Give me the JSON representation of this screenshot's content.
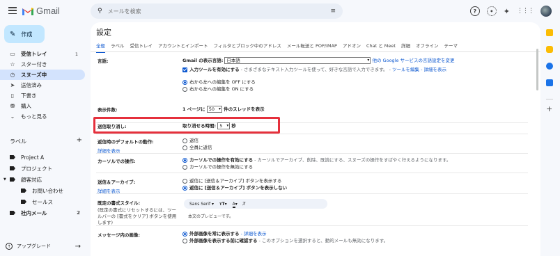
{
  "app": {
    "name": "Gmail"
  },
  "search": {
    "placeholder": "メールを検索"
  },
  "compose": {
    "label": "作成"
  },
  "nav": [
    {
      "label": "受信トレイ",
      "count": "1",
      "icon": "inbox-icon",
      "glyph": "▭",
      "bold": true
    },
    {
      "label": "スター付き",
      "count": "",
      "icon": "star-icon",
      "glyph": "☆"
    },
    {
      "label": "スヌーズ中",
      "count": "",
      "icon": "clock-icon",
      "glyph": "◷",
      "active": true
    },
    {
      "label": "送信済み",
      "count": "",
      "icon": "send-icon",
      "glyph": "➤"
    },
    {
      "label": "下書き",
      "count": "",
      "icon": "draft-icon",
      "glyph": "▯"
    },
    {
      "label": "購入",
      "count": "",
      "icon": "bag-icon",
      "glyph": "⛃"
    },
    {
      "label": "もっと見る",
      "count": "",
      "icon": "chevron-down-icon",
      "glyph": "⌄"
    }
  ],
  "labels": {
    "heading": "ラベル",
    "add": "+",
    "items": [
      {
        "label": "Project A"
      },
      {
        "label": "プロジェクト"
      },
      {
        "label": "顧客対応",
        "expanded": true
      },
      {
        "label": "お問い合わせ",
        "sub": true
      },
      {
        "label": "セールス",
        "sub": true
      },
      {
        "label": "社内メール",
        "count": "2",
        "bold": true
      }
    ]
  },
  "upgrade": {
    "label": "アップグレード"
  },
  "settings": {
    "title": "設定",
    "tabs": [
      "全般",
      "ラベル",
      "受信トレイ",
      "アカウントとインポート",
      "フィルタとブロック中のアドレス",
      "メール転送と POP/IMAP",
      "アドオン",
      "Chat と Meet",
      "詳細",
      "オフライン",
      "テーマ"
    ],
    "language": {
      "label": "言語:",
      "display_prefix": "Gmail の表示言語:",
      "display_value": "日本語",
      "display_link": "他の Google サービスの言語設定を変更",
      "input_check": "入力ツールを有効にする",
      "input_desc": " - さまざまなテキスト入力ツールを使って、好きな言語で入力できます。 - ",
      "input_link": "ツールを編集 - 詳細を表示",
      "rtl_off": "右から左への編集を OFF にする",
      "rtl_on": "右から左への編集を ON にする"
    },
    "page_size": {
      "label": "表示件数:",
      "prefix": "1 ページに",
      "value": "50",
      "suffix": "件のスレッドを表示"
    },
    "undo_send": {
      "label": "送信取り消し:",
      "prefix": "取り消せる時間:",
      "value": "5",
      "suffix": "秒"
    },
    "reply_default": {
      "label": "返信時のデフォルトの動作:",
      "link": "詳細を表示",
      "opt1": "返信",
      "opt2": "全員に返信"
    },
    "cursor": {
      "label": "カーソルでの操作:",
      "opt1": "カーソルでの操作を有効にする",
      "opt1_desc": " - カーソルでアーカイブ、削除、既読にする、スヌーズの操作をすばやく行えるようになります。",
      "opt2": "カーソルでの操作を無効にする"
    },
    "send_archive": {
      "label": "送信＆アーカイブ:",
      "link": "詳細を表示",
      "opt1": "返信に [送信＆アーカイブ] ボタンを表示する",
      "opt2": "返信に [送信＆アーカイブ] ボタンを表示しない"
    },
    "default_style": {
      "label": "既定の書式スタイル:",
      "note": "(既定の書式にリセットするには、ツールバーの [書式をクリア] ボタンを使用します)",
      "font": "Sans Serif",
      "preview": "本文のプレビューです。"
    },
    "images": {
      "label": "メッセージ内の画像:",
      "opt1": "外部画像を常に表示する",
      "opt1_link": " - 詳細を表示",
      "opt2": "外部画像を表示する前に確認する",
      "opt2_desc": " - このオプションを選択すると、動的メールも無効になります。"
    }
  },
  "colors": {
    "accent": "#0b57d0",
    "highlight": "#e5303c",
    "compose_bg": "#c2e7ff",
    "active_nav": "#d3e3fd"
  }
}
